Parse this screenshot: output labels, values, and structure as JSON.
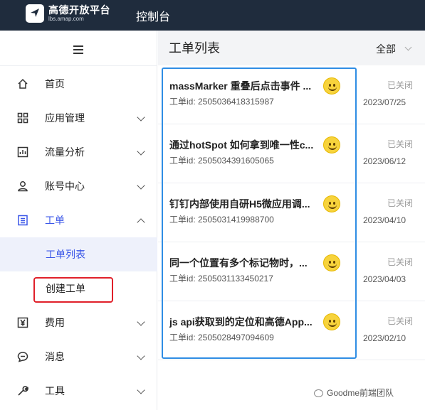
{
  "topbar": {
    "logo_title": "高德开放平台",
    "logo_sub": "lbs.amap.com",
    "console": "控制台",
    "bg_color": "#1f2c3d"
  },
  "sidebar": {
    "menu_icon": "hamburger-icon",
    "items": [
      {
        "label": "首页",
        "icon": "home-icon"
      },
      {
        "label": "应用管理",
        "icon": "grid-icon"
      },
      {
        "label": "流量分析",
        "icon": "chart-icon"
      },
      {
        "label": "账号中心",
        "icon": "user-icon"
      },
      {
        "label": "工单",
        "icon": "ticket-icon"
      },
      {
        "label": "费用",
        "icon": "yen-icon"
      },
      {
        "label": "消息",
        "icon": "message-icon"
      },
      {
        "label": "工具",
        "icon": "wrench-icon"
      }
    ],
    "sub_items": [
      {
        "label": "工单列表"
      },
      {
        "label": "创建工单"
      }
    ],
    "accent_color": "#3a56e8"
  },
  "main": {
    "title": "工单列表",
    "filter": "全部",
    "tickets": [
      {
        "title": "massMarker 重叠后点击事件 ...",
        "id": "工单id: 2505036418315987",
        "status": "已关闭",
        "date": "2023/07/25"
      },
      {
        "title": "通过hotSpot 如何拿到唯一性c...",
        "id": "工单id: 2505034391605065",
        "status": "已关闭",
        "date": "2023/06/12"
      },
      {
        "title": "钉钉内部使用自研H5微应用调...",
        "id": "工单id: 2505031419988700",
        "status": "已关闭",
        "date": "2023/04/10"
      },
      {
        "title": "同一个位置有多个标记物时，...",
        "id": "工单id: 2505031133450217",
        "status": "已关闭",
        "date": "2023/04/03"
      },
      {
        "title": "js api获取到的定位和高德App...",
        "id": "工单id: 2505028497094609",
        "status": "已关闭",
        "date": "2023/02/10"
      }
    ]
  },
  "watermark": "Goodme前端团队"
}
